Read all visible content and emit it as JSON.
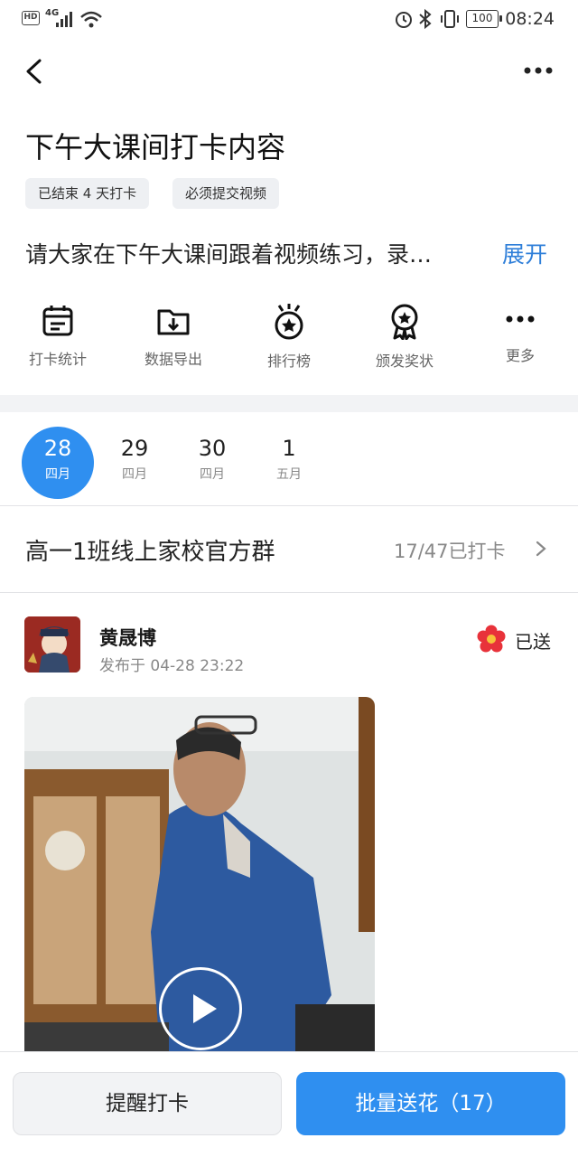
{
  "status_bar": {
    "hd": "HD",
    "network": "4G",
    "battery": "100",
    "time": "08:24"
  },
  "header": {
    "back_icon": "chevron-left-icon",
    "more_icon": "more-horizontal-icon"
  },
  "task": {
    "title": "下午大课间打卡内容",
    "tags": [
      "已结束 4 天打卡",
      "必须提交视频"
    ],
    "description": "请大家在下午大课间跟着视频练习，录…",
    "expand_label": "展开"
  },
  "actions": [
    {
      "label": "打卡统计",
      "icon": "calendar-stats-icon"
    },
    {
      "label": "数据导出",
      "icon": "folder-download-icon"
    },
    {
      "label": "排行榜",
      "icon": "medal-star-icon"
    },
    {
      "label": "颁发奖状",
      "icon": "award-ribbon-icon"
    },
    {
      "label": "更多",
      "icon": "more-horizontal-icon"
    }
  ],
  "dates": [
    {
      "day": "28",
      "month": "四月",
      "selected": true
    },
    {
      "day": "29",
      "month": "四月",
      "selected": false
    },
    {
      "day": "30",
      "month": "四月",
      "selected": false
    },
    {
      "day": "1",
      "month": "五月",
      "selected": false
    }
  ],
  "group": {
    "name": "高一1班线上家校官方群",
    "count": "17/47已打卡"
  },
  "post": {
    "author": "黄晟博",
    "time": "发布于 04-28 23:22",
    "flower_status": "已送"
  },
  "bottom": {
    "remind_label": "提醒打卡",
    "flowers_label": "批量送花（17）"
  },
  "colors": {
    "accent": "#2f8ff0",
    "link": "#2f7fd9",
    "flower": "#e8323a"
  }
}
